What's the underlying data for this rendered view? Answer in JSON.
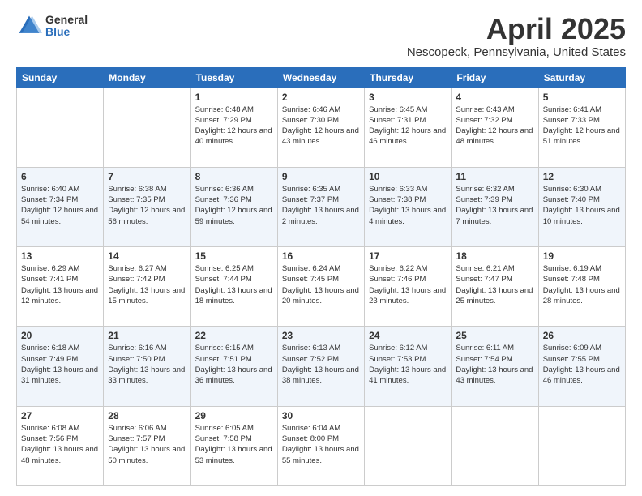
{
  "logo": {
    "general": "General",
    "blue": "Blue"
  },
  "header": {
    "title": "April 2025",
    "subtitle": "Nescopeck, Pennsylvania, United States"
  },
  "weekdays": [
    "Sunday",
    "Monday",
    "Tuesday",
    "Wednesday",
    "Thursday",
    "Friday",
    "Saturday"
  ],
  "weeks": [
    [
      {
        "day": "",
        "info": ""
      },
      {
        "day": "",
        "info": ""
      },
      {
        "day": "1",
        "info": "Sunrise: 6:48 AM\nSunset: 7:29 PM\nDaylight: 12 hours and 40 minutes."
      },
      {
        "day": "2",
        "info": "Sunrise: 6:46 AM\nSunset: 7:30 PM\nDaylight: 12 hours and 43 minutes."
      },
      {
        "day": "3",
        "info": "Sunrise: 6:45 AM\nSunset: 7:31 PM\nDaylight: 12 hours and 46 minutes."
      },
      {
        "day": "4",
        "info": "Sunrise: 6:43 AM\nSunset: 7:32 PM\nDaylight: 12 hours and 48 minutes."
      },
      {
        "day": "5",
        "info": "Sunrise: 6:41 AM\nSunset: 7:33 PM\nDaylight: 12 hours and 51 minutes."
      }
    ],
    [
      {
        "day": "6",
        "info": "Sunrise: 6:40 AM\nSunset: 7:34 PM\nDaylight: 12 hours and 54 minutes."
      },
      {
        "day": "7",
        "info": "Sunrise: 6:38 AM\nSunset: 7:35 PM\nDaylight: 12 hours and 56 minutes."
      },
      {
        "day": "8",
        "info": "Sunrise: 6:36 AM\nSunset: 7:36 PM\nDaylight: 12 hours and 59 minutes."
      },
      {
        "day": "9",
        "info": "Sunrise: 6:35 AM\nSunset: 7:37 PM\nDaylight: 13 hours and 2 minutes."
      },
      {
        "day": "10",
        "info": "Sunrise: 6:33 AM\nSunset: 7:38 PM\nDaylight: 13 hours and 4 minutes."
      },
      {
        "day": "11",
        "info": "Sunrise: 6:32 AM\nSunset: 7:39 PM\nDaylight: 13 hours and 7 minutes."
      },
      {
        "day": "12",
        "info": "Sunrise: 6:30 AM\nSunset: 7:40 PM\nDaylight: 13 hours and 10 minutes."
      }
    ],
    [
      {
        "day": "13",
        "info": "Sunrise: 6:29 AM\nSunset: 7:41 PM\nDaylight: 13 hours and 12 minutes."
      },
      {
        "day": "14",
        "info": "Sunrise: 6:27 AM\nSunset: 7:42 PM\nDaylight: 13 hours and 15 minutes."
      },
      {
        "day": "15",
        "info": "Sunrise: 6:25 AM\nSunset: 7:44 PM\nDaylight: 13 hours and 18 minutes."
      },
      {
        "day": "16",
        "info": "Sunrise: 6:24 AM\nSunset: 7:45 PM\nDaylight: 13 hours and 20 minutes."
      },
      {
        "day": "17",
        "info": "Sunrise: 6:22 AM\nSunset: 7:46 PM\nDaylight: 13 hours and 23 minutes."
      },
      {
        "day": "18",
        "info": "Sunrise: 6:21 AM\nSunset: 7:47 PM\nDaylight: 13 hours and 25 minutes."
      },
      {
        "day": "19",
        "info": "Sunrise: 6:19 AM\nSunset: 7:48 PM\nDaylight: 13 hours and 28 minutes."
      }
    ],
    [
      {
        "day": "20",
        "info": "Sunrise: 6:18 AM\nSunset: 7:49 PM\nDaylight: 13 hours and 31 minutes."
      },
      {
        "day": "21",
        "info": "Sunrise: 6:16 AM\nSunset: 7:50 PM\nDaylight: 13 hours and 33 minutes."
      },
      {
        "day": "22",
        "info": "Sunrise: 6:15 AM\nSunset: 7:51 PM\nDaylight: 13 hours and 36 minutes."
      },
      {
        "day": "23",
        "info": "Sunrise: 6:13 AM\nSunset: 7:52 PM\nDaylight: 13 hours and 38 minutes."
      },
      {
        "day": "24",
        "info": "Sunrise: 6:12 AM\nSunset: 7:53 PM\nDaylight: 13 hours and 41 minutes."
      },
      {
        "day": "25",
        "info": "Sunrise: 6:11 AM\nSunset: 7:54 PM\nDaylight: 13 hours and 43 minutes."
      },
      {
        "day": "26",
        "info": "Sunrise: 6:09 AM\nSunset: 7:55 PM\nDaylight: 13 hours and 46 minutes."
      }
    ],
    [
      {
        "day": "27",
        "info": "Sunrise: 6:08 AM\nSunset: 7:56 PM\nDaylight: 13 hours and 48 minutes."
      },
      {
        "day": "28",
        "info": "Sunrise: 6:06 AM\nSunset: 7:57 PM\nDaylight: 13 hours and 50 minutes."
      },
      {
        "day": "29",
        "info": "Sunrise: 6:05 AM\nSunset: 7:58 PM\nDaylight: 13 hours and 53 minutes."
      },
      {
        "day": "30",
        "info": "Sunrise: 6:04 AM\nSunset: 8:00 PM\nDaylight: 13 hours and 55 minutes."
      },
      {
        "day": "",
        "info": ""
      },
      {
        "day": "",
        "info": ""
      },
      {
        "day": "",
        "info": ""
      }
    ]
  ]
}
